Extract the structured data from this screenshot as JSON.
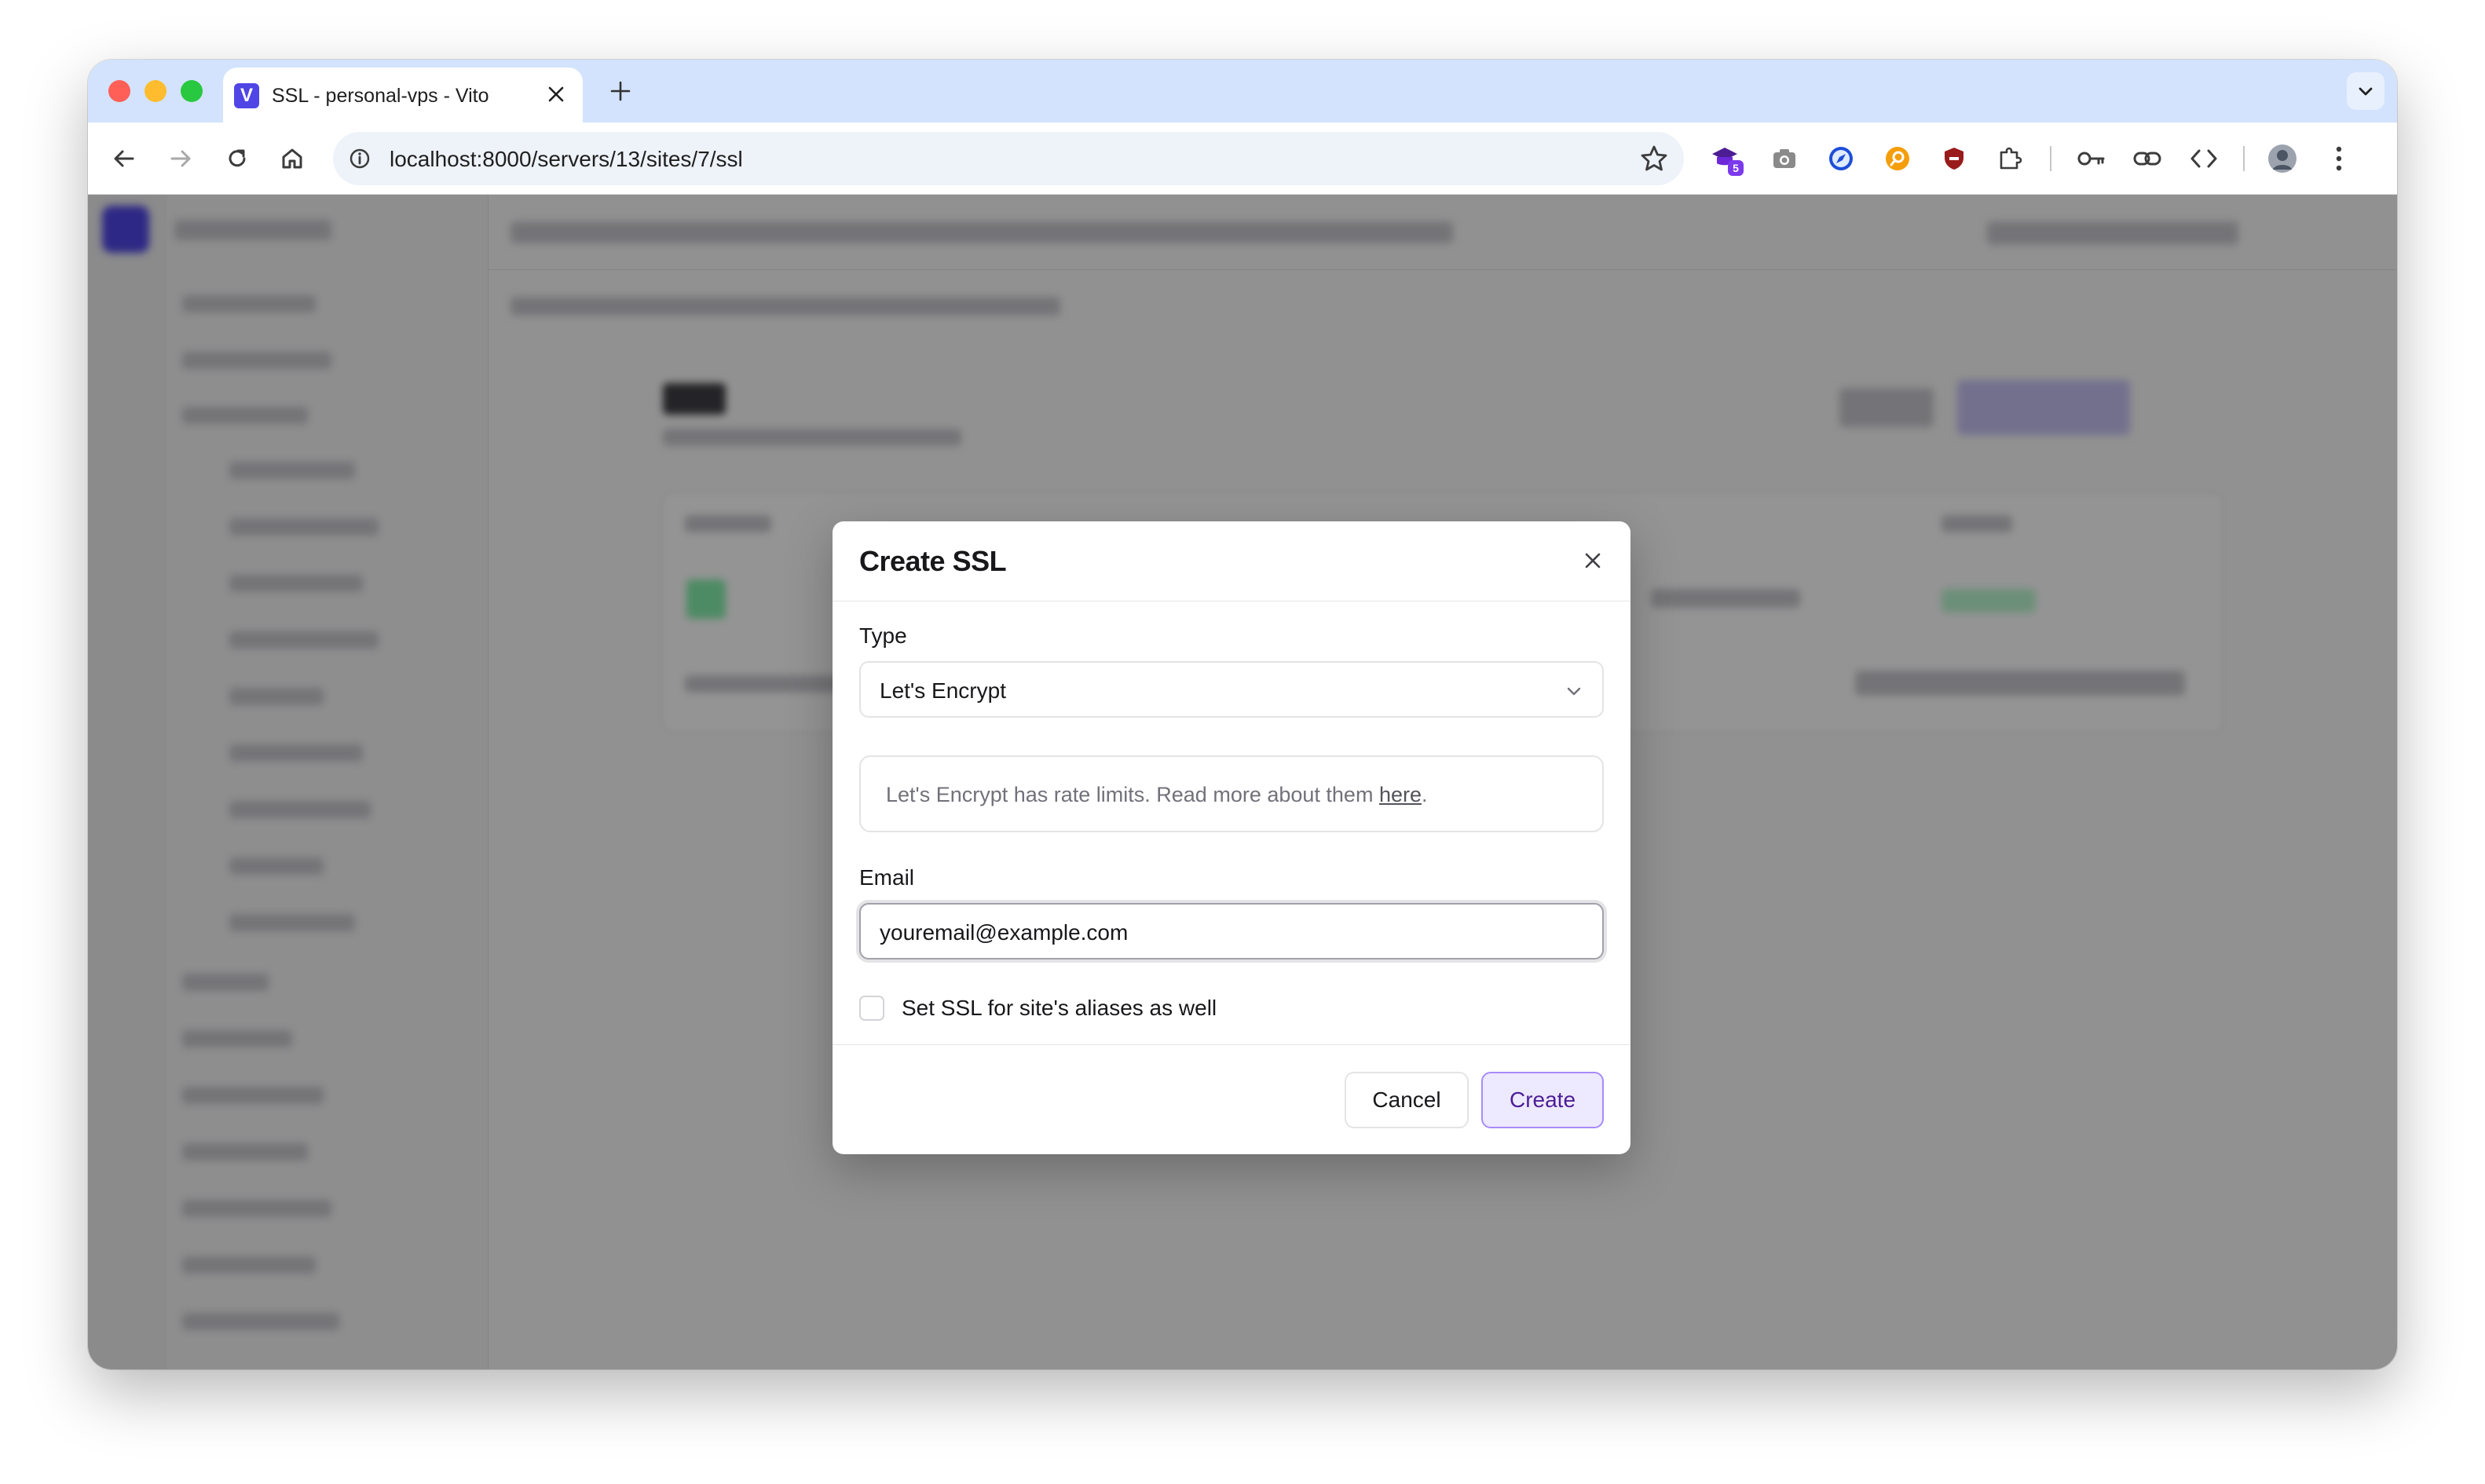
{
  "browser": {
    "tab_title": "SSL - personal-vps - Vito",
    "favicon_letter": "V",
    "url": "localhost:8000/servers/13/sites/7/ssl",
    "extension_badge": "5"
  },
  "modal": {
    "title": "Create SSL",
    "type_label": "Type",
    "type_value": "Let's Encrypt",
    "alert_text": "Let's Encrypt has rate limits. Read more about them ",
    "alert_link": "here",
    "alert_end": ".",
    "email_label": "Email",
    "email_value": "youremail@example.com",
    "aliases_label": "Set SSL for site's aliases as well",
    "aliases_checked": false,
    "cancel_label": "Cancel",
    "create_label": "Create"
  },
  "colors": {
    "accent": "#4f46e5",
    "create_bg": "#ede9fe",
    "create_border": "#a78bfa"
  }
}
